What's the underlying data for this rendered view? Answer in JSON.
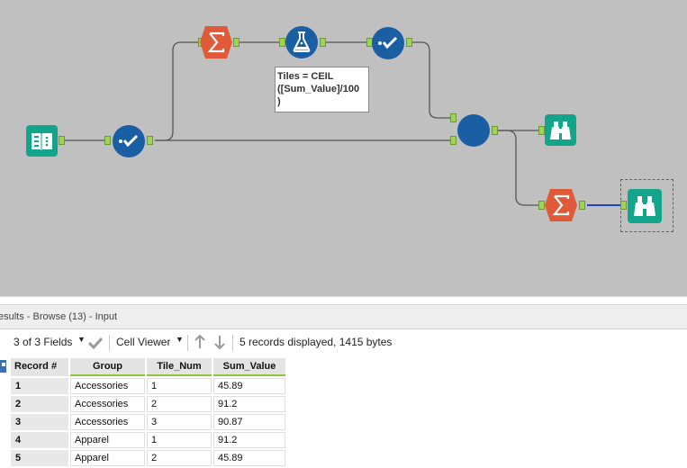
{
  "canvas": {
    "background_color": "#c0c0c0",
    "formula_annotation": "Tiles = CEIL\n([Sum_Value]/100\n)",
    "tools": [
      {
        "name": "input-data-tool",
        "icon": "book-icon",
        "color": "#12a58b"
      },
      {
        "name": "select-tool-1",
        "icon": "checkmark-icon",
        "color": "#1a5fa3"
      },
      {
        "name": "summarize-tool-1",
        "icon": "sigma-icon",
        "color": "#e05a3a"
      },
      {
        "name": "formula-tool",
        "icon": "flask-icon",
        "color": "#1a5fa3"
      },
      {
        "name": "select-tool-2",
        "icon": "checkmark-icon",
        "color": "#1a5fa3"
      },
      {
        "name": "join-tool",
        "icon": "circle-icon",
        "color": "#1a5fa3"
      },
      {
        "name": "browse-tool-1",
        "icon": "binoculars-icon",
        "color": "#12a58b"
      },
      {
        "name": "summarize-tool-2",
        "icon": "sigma-icon",
        "color": "#e05a3a"
      },
      {
        "name": "browse-tool-2",
        "icon": "binoculars-icon",
        "color": "#12a58b"
      }
    ]
  },
  "results": {
    "title": "esults - Browse (13) - Input",
    "fields_select": "3 of 3 Fields",
    "viewer_select": "Cell Viewer",
    "status": "5 records displayed, 1415 bytes",
    "columns": [
      "Record #",
      "Group",
      "Tile_Num",
      "Sum_Value"
    ],
    "rows": [
      [
        "1",
        "Accessories",
        "1",
        "45.89"
      ],
      [
        "2",
        "Accessories",
        "2",
        "91.2"
      ],
      [
        "3",
        "Accessories",
        "3",
        "90.87"
      ],
      [
        "4",
        "Apparel",
        "1",
        "91.2"
      ],
      [
        "5",
        "Apparel",
        "2",
        "45.89"
      ]
    ]
  }
}
